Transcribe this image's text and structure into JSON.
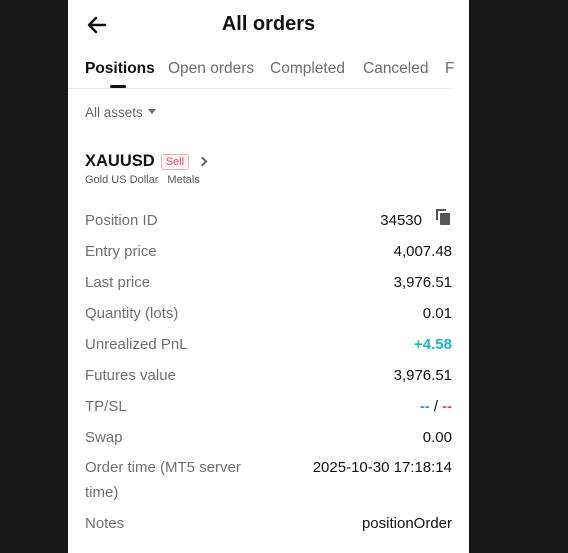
{
  "header": {
    "title": "All orders"
  },
  "tabs": [
    "Positions",
    "Open orders",
    "Completed",
    "Canceled",
    "F"
  ],
  "filter": {
    "label": "All assets"
  },
  "instrument": {
    "symbol": "XAUUSD",
    "side": "Sell",
    "name": "Gold US Dollar",
    "category": "Metals"
  },
  "details": {
    "position_id": {
      "label": "Position ID",
      "value": "34530"
    },
    "entry_price": {
      "label": "Entry price",
      "value": "4,007.48"
    },
    "last_price": {
      "label": "Last price",
      "value": "3,976.51"
    },
    "quantity": {
      "label": "Quantity (lots)",
      "value": "0.01"
    },
    "unrealized_pnl": {
      "label": "Unrealized PnL",
      "value": "+4.58"
    },
    "futures_value": {
      "label": "Futures value",
      "value": "3,976.51"
    },
    "tpsl": {
      "label": "TP/SL",
      "tp": "--",
      "slash": "/",
      "sl": "--"
    },
    "swap": {
      "label": "Swap",
      "value": "0.00"
    },
    "order_time": {
      "label": "Order time (MT5 server time)",
      "value": "2025-10-30 17:18:14"
    },
    "notes": {
      "label": "Notes",
      "value": "positionOrder"
    }
  },
  "colors": {
    "positive": "#19b6c4",
    "tp": "#2a9ad9",
    "sl": "#e24b6a",
    "background": "#171717"
  },
  "icons": {
    "back": "arrow-left-icon",
    "copy": "copy-icon",
    "filter": "caret-down-icon",
    "symbol": "chevron-right-icon"
  }
}
